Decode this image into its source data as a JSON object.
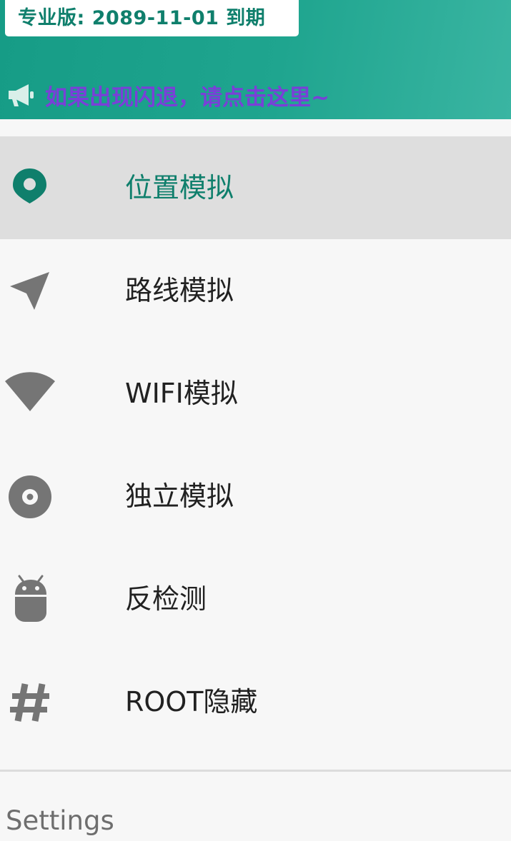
{
  "header": {
    "badge_text": "专业版: 2089-11-01 到期",
    "notice_icon": "megaphone-icon",
    "notice_text": "如果出现闪退，请点击这里~",
    "colors": {
      "header_bg": "#1fa58f",
      "badge_text": "#0f7f6c",
      "notice_text": "#7a3fd8"
    }
  },
  "menu": {
    "items": [
      {
        "label": "位置模拟",
        "icon": "location-pin-icon",
        "active": true
      },
      {
        "label": "路线模拟",
        "icon": "navigation-arrow-icon",
        "active": false
      },
      {
        "label": "WIFI模拟",
        "icon": "wifi-icon",
        "active": false
      },
      {
        "label": "独立模拟",
        "icon": "disc-icon",
        "active": false
      },
      {
        "label": "反检测",
        "icon": "android-icon",
        "active": false
      },
      {
        "label": "ROOT隐藏",
        "icon": "hash-icon",
        "active": false
      }
    ],
    "colors": {
      "active_bg": "#dedede",
      "active_text": "#0f7f6c",
      "icon_inactive": "#757575",
      "icon_active": "#0f7f6c"
    }
  },
  "settings": {
    "section_title": "Settings"
  }
}
